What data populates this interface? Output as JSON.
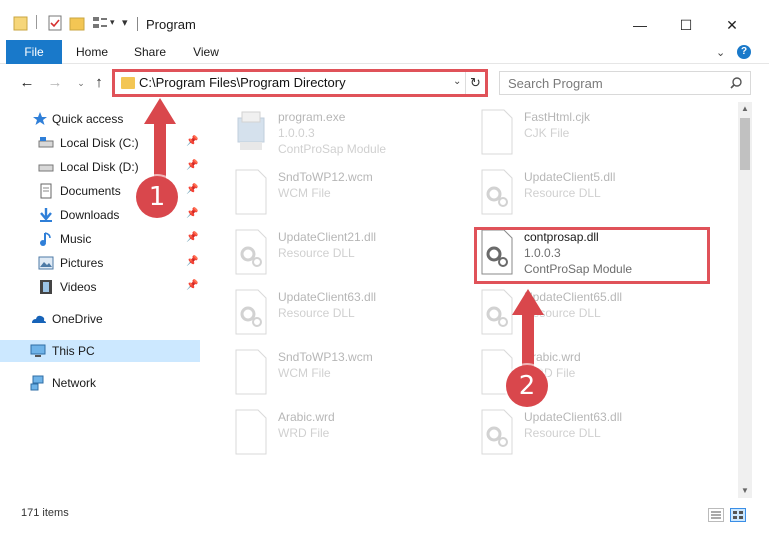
{
  "window": {
    "title": "Program",
    "controls": {
      "minimize": "—",
      "maximize": "☐",
      "close": "✕"
    }
  },
  "ribbon": {
    "tabs": [
      "File",
      "Home",
      "Share",
      "View"
    ],
    "help": "?"
  },
  "navigation": {
    "address": "C:\\Program Files\\Program Directory",
    "search_placeholder": "Search Program"
  },
  "sidebar": {
    "items": [
      {
        "label": "Quick access",
        "icon": "star-icon",
        "pinned": false
      },
      {
        "label": "Local Disk (C:)",
        "icon": "drive-icon",
        "pinned": true
      },
      {
        "label": "Local Disk (D:)",
        "icon": "drive-icon",
        "pinned": true
      },
      {
        "label": "Documents",
        "icon": "documents-icon",
        "pinned": true
      },
      {
        "label": "Downloads",
        "icon": "download-icon",
        "pinned": true
      },
      {
        "label": "Music",
        "icon": "music-icon",
        "pinned": true
      },
      {
        "label": "Pictures",
        "icon": "pictures-icon",
        "pinned": true
      },
      {
        "label": "Videos",
        "icon": "videos-icon",
        "pinned": true
      },
      {
        "label": "OneDrive",
        "icon": "onedrive-icon",
        "pinned": false
      },
      {
        "label": "This PC",
        "icon": "pc-icon",
        "pinned": false,
        "selected": true
      },
      {
        "label": "Network",
        "icon": "network-icon",
        "pinned": false
      }
    ]
  },
  "files": [
    {
      "name": "program.exe",
      "meta1": "1.0.0.3",
      "meta2": "ContProSap Module",
      "type": "exe",
      "faded": true
    },
    {
      "name": "FastHtml.cjk",
      "meta1": "CJK File",
      "meta2": "",
      "type": "doc",
      "faded": true
    },
    {
      "name": "SndToWP12.wcm",
      "meta1": "WCM File",
      "meta2": "",
      "type": "doc",
      "faded": true
    },
    {
      "name": "UpdateClient5.dll",
      "meta1": "Resource DLL",
      "meta2": "",
      "type": "dll",
      "faded": true
    },
    {
      "name": "UpdateClient21.dll",
      "meta1": "Resource DLL",
      "meta2": "",
      "type": "dll",
      "faded": true
    },
    {
      "name": "contprosap.dll",
      "meta1": "1.0.0.3",
      "meta2": "ContProSap Module",
      "type": "dll",
      "faded": false
    },
    {
      "name": "UpdateClient63.dll",
      "meta1": "Resource DLL",
      "meta2": "",
      "type": "dll",
      "faded": true
    },
    {
      "name": "UpdateClient65.dll",
      "meta1": "Resource DLL",
      "meta2": "",
      "type": "dll",
      "faded": true
    },
    {
      "name": "SndToWP13.wcm",
      "meta1": "WCM File",
      "meta2": "",
      "type": "doc",
      "faded": true
    },
    {
      "name": "Arabic.wrd",
      "meta1": "WRD File",
      "meta2": "",
      "type": "doc",
      "faded": true
    },
    {
      "name": "Arabic.wrd",
      "meta1": "WRD File",
      "meta2": "",
      "type": "doc",
      "faded": true
    },
    {
      "name": "UpdateClient63.dll",
      "meta1": "Resource DLL",
      "meta2": "",
      "type": "dll",
      "faded": true
    }
  ],
  "status": {
    "item_count": "171 items"
  },
  "annotations": {
    "step1": "1",
    "step2": "2",
    "accent": "#d9474c"
  }
}
